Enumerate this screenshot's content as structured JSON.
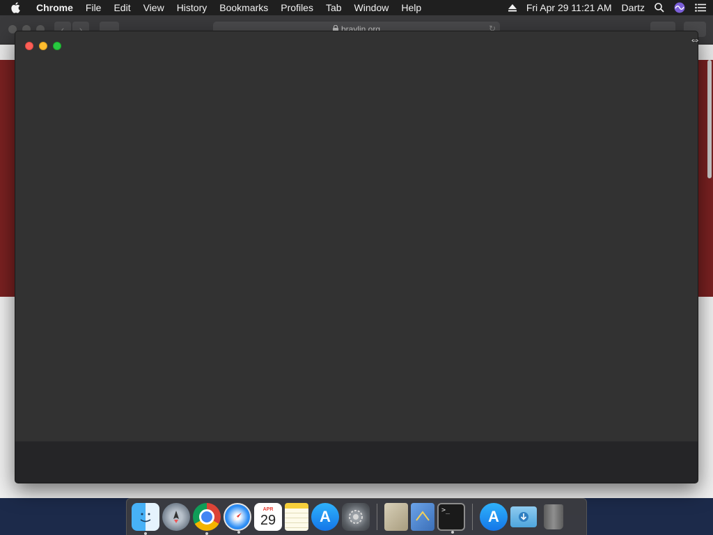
{
  "menubar": {
    "apple_icon": "apple-logo-icon",
    "app_name": "Chrome",
    "menus": [
      "File",
      "Edit",
      "View",
      "History",
      "Bookmarks",
      "Profiles",
      "Tab",
      "Window",
      "Help"
    ],
    "datetime": "Fri Apr 29  11:21 AM",
    "user": "Dartz",
    "status_icons": [
      "eject-icon",
      "spotlight-search-icon",
      "siri-icon",
      "notification-center-icon"
    ]
  },
  "background_browser": {
    "address": "braylin.org",
    "lock_icon": "lock-icon",
    "reload_icon": "reload-icon",
    "back_label": "‹",
    "forward_label": "›",
    "banner_color": "#7a2121"
  },
  "foreground_window": {
    "background_color": "#323232",
    "traffic_lights": {
      "close": "#fc5f57",
      "minimize": "#fdbc2e",
      "zoom": "#28c840"
    }
  },
  "cursor": {
    "type": "resize-horizontal-cursor",
    "glyph": "⇔"
  },
  "dock": {
    "apps": [
      {
        "name": "Finder",
        "icon": "finder-icon",
        "running": true
      },
      {
        "name": "Launchpad",
        "icon": "launchpad-icon",
        "running": false
      },
      {
        "name": "Google Chrome",
        "icon": "chrome-icon",
        "running": true
      },
      {
        "name": "Safari",
        "icon": "safari-icon",
        "running": true
      },
      {
        "name": "Calendar",
        "icon": "calendar-icon",
        "running": false,
        "month": "APR",
        "day": "29"
      },
      {
        "name": "Notes",
        "icon": "notes-icon",
        "running": false
      },
      {
        "name": "App Store",
        "icon": "app-store-icon",
        "running": false
      },
      {
        "name": "System Preferences",
        "icon": "system-preferences-icon",
        "running": false
      },
      {
        "name": "Preview",
        "icon": "preview-icon",
        "running": false
      },
      {
        "name": "Mail",
        "icon": "mail-icon",
        "running": false
      },
      {
        "name": "Terminal",
        "icon": "terminal-icon",
        "running": true,
        "prompt": ">_"
      }
    ],
    "stacks": [
      {
        "name": "Applications",
        "icon": "applications-folder-icon"
      },
      {
        "name": "Downloads",
        "icon": "downloads-folder-icon"
      },
      {
        "name": "Trash",
        "icon": "trash-icon"
      }
    ]
  }
}
